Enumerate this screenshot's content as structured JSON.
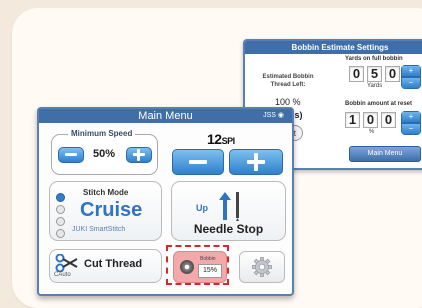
{
  "bobbin_settings": {
    "title": "Bobbin Estimate Settings",
    "estimated_label": "Estimated Bobbin Thread Left:",
    "estimated_value": "100 %",
    "yards_partial": "Yards)",
    "reset_partial": "set",
    "full_bobbin_label": "Yards on full bobbin",
    "full_digits": [
      "0",
      "5",
      "0"
    ],
    "full_unit": "Yards",
    "amount_label": "Bobbin amount at reset",
    "amount_digits": [
      "1",
      "0",
      "0"
    ],
    "amount_unit": "%",
    "main_menu_label": "Main Menu"
  },
  "main_menu": {
    "title": "Main Menu",
    "corner_text": "JSS",
    "min_speed_label": "Minimum Speed",
    "min_speed_value": "50%",
    "spi_value": "12",
    "spi_unit": "SPI",
    "stitch_mode_label": "Stitch Mode",
    "stitch_mode_value": "Cruise",
    "stitch_mode_sub": "JUKI SmartStitch",
    "needle_direction": "Up",
    "needle_label": "Needle Stop",
    "cut_label": "Cut Thread",
    "cut_auto": "CAuto",
    "bobbin_label": "Bobbin",
    "bobbin_value": "15%"
  },
  "colors": {
    "accent": "#3f6ea8",
    "button_blue": "#2f7fcc",
    "bobbin_highlight": "#d62828",
    "bobbin_pink": "#f3a9ab"
  }
}
